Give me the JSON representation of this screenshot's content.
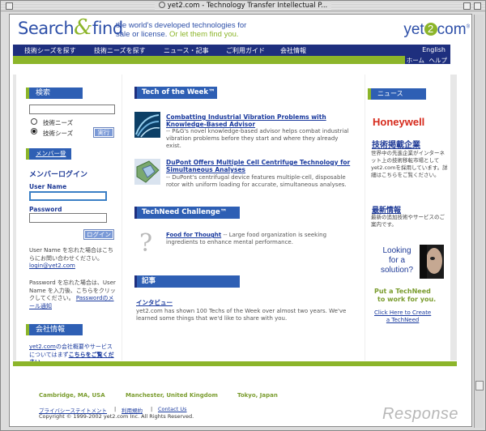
{
  "window": {
    "title": "yet2.com - Technology Transfer Intellectual P..."
  },
  "header": {
    "logo_search": "Search",
    "logo_amp": "&",
    "logo_find": "find",
    "tagline_line1": "the world's developed technologies for",
    "tagline_line2_a": "sale or license.",
    "tagline_line2_b": "Or let them find you.",
    "brand_prefix": "yet",
    "brand_two": "2",
    "brand_suffix": "com",
    "brand_mark": "®"
  },
  "nav": {
    "items": [
      "技術シーズを探す",
      "技術ニーズを探す",
      "ニュース・記事",
      "ご利用ガイド",
      "会社情報"
    ],
    "english": "English",
    "home": "ホーム",
    "help": "ヘルプ"
  },
  "search": {
    "heading": "検索",
    "option_needs": "技術ニーズ",
    "option_seeds": "技術シーズ",
    "submit": "実行",
    "selected": "技術シーズ"
  },
  "member": {
    "register_link": "メンバー登録",
    "login_heading": "メンバーログイン",
    "username_label": "User Name",
    "password_label": "Password",
    "login_button": "ログイン",
    "forgot_user_text": "User Name を忘れた場合はこちらにお問い合わせください。",
    "forgot_user_link": "login@yet2.com",
    "forgot_pw_text": "Password を忘れた場合は、User Name を入力後、こちらをクリックしてください。",
    "forgot_pw_link": "Passwordのメール通知"
  },
  "company": {
    "heading": "会社情報",
    "text_link": "yet2.com",
    "text": "の会社概要やサービスについてはまず",
    "text_link2": "こちらをご覧ください。"
  },
  "tech_week": {
    "heading": "Tech of the Week™",
    "items": [
      {
        "title": "Combatting Industrial Vibration Problems with Knowledge-Based Advisor",
        "desc": "-- P&G's novel knowledge-based advisor helps combat industrial vibration problems before they start and where they already exist."
      },
      {
        "title": "DuPont Offers Multiple Cell Centrifuge Technology for Simultaneous Analyses",
        "desc": "-- DuPont's centrifugal device features multiple-cell, disposable rotor with uniform loading for accurate, simultaneous analyses."
      }
    ]
  },
  "tech_need": {
    "heading": "TechNeed Challenge™",
    "title": "Food for Thought",
    "desc": "-- Large food organization is seeking ingredients to enhance mental performance."
  },
  "articles": {
    "heading": "記事",
    "title": "インタビュー",
    "desc": "yet2.com has shown 100 Techs of the Week over almost two years. We've learned some things that we'd like to share with you."
  },
  "news": {
    "heading": "ニュース",
    "sponsor": "Honeywell",
    "ad_title": "技術掲載企業",
    "ad_text": "世界中の先進企業がインターネット上の技術移転市場としてyet2.comを採用しています。詳細はこちらをご覧ください。",
    "latest_title": "最新情報",
    "latest_text": "最新の追加技術やサービスのご案内です。",
    "promo_line1": "Looking",
    "promo_line2": "for a",
    "promo_line3": "solution?",
    "promo_cta1": "Put a TechNeed",
    "promo_cta2": "to work for you.",
    "promo_link1": "Click Here to Create",
    "promo_link2": "a TechNeed"
  },
  "footer": {
    "cities": [
      "Cambridge, MA, USA",
      "Manchester, United Kingdom",
      "Tokyo, Japan"
    ],
    "links": [
      "プライバシーステイトメント",
      "利用規約",
      "Contact Us"
    ],
    "copyright": "Copyright © 1999-2002 yet2.com Inc. All Rights Reserved."
  },
  "watermark": "Response",
  "colors": {
    "brand_blue": "#2d4fa8",
    "nav_blue": "#1e2f7e",
    "accent_green": "#8cb52a",
    "panel_blue": "#2e5fb4"
  }
}
